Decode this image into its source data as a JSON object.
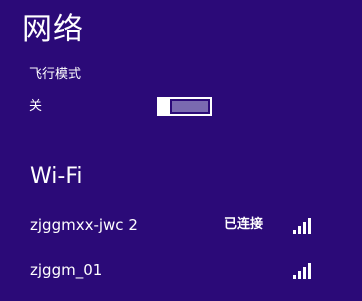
{
  "header": {
    "title": "网络"
  },
  "airplane_mode": {
    "label": "飞行模式",
    "state_label": "关",
    "enabled": false
  },
  "wifi": {
    "section_title": "Wi-Fi",
    "networks": [
      {
        "name": "zjggmxx-jwc 2",
        "status": "已连接",
        "signal_bars": 4,
        "icon": "wifi-signal-icon"
      },
      {
        "name": "zjggm_01",
        "status": "",
        "signal_bars": 4,
        "icon": "wifi-signal-icon"
      }
    ]
  },
  "colors": {
    "background": "#2b0a78",
    "text": "#ffffff",
    "toggle_off_fill": "#7a6ab0"
  }
}
